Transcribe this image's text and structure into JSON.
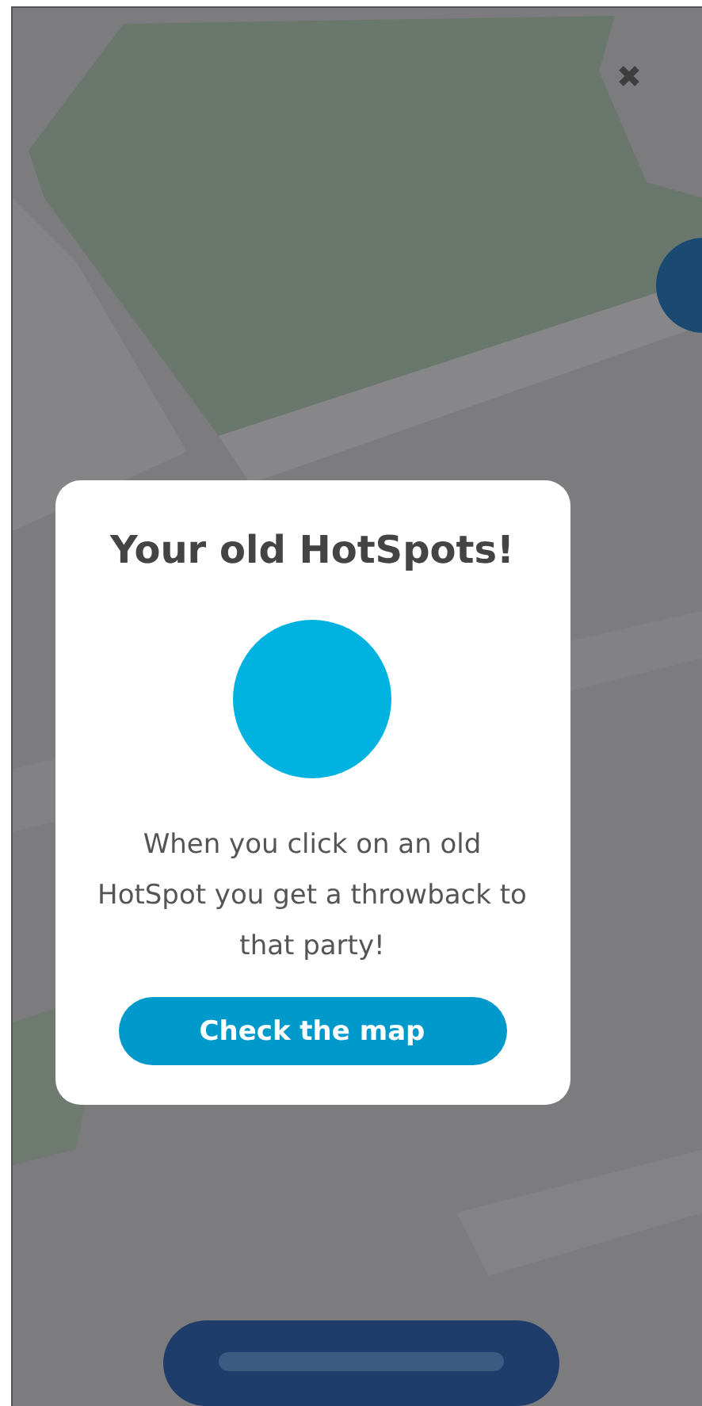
{
  "dialog": {
    "title": "Your old HotSpots!",
    "message": "When you click on an old HotSpot you get a throwback to that party!",
    "button": "Check the map"
  }
}
